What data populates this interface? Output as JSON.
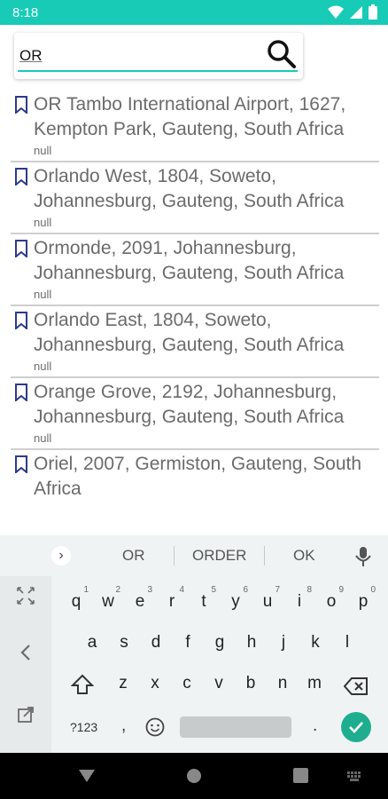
{
  "status_bar": {
    "time": "8:18",
    "icons": [
      "wifi-icon",
      "signal-icon",
      "battery-icon"
    ],
    "color": "#17cbb6"
  },
  "search": {
    "value": "OR",
    "icon": "search-icon",
    "accent": "#17cbb6"
  },
  "results": [
    {
      "title": "OR Tambo International  Airport, 1627, Kempton Park, Gauteng, South Africa",
      "subtitle": "null"
    },
    {
      "title": "Orlando West, 1804, Soweto, Johannesburg, Gauteng, South Africa",
      "subtitle": "null"
    },
    {
      "title": "Ormonde, 2091, Johannesburg, Johannesburg, Gauteng, South Africa",
      "subtitle": "null"
    },
    {
      "title": "Orlando East, 1804, Soweto, Johannesburg, Gauteng, South Africa",
      "subtitle": "null"
    },
    {
      "title": "Orange Grove, 2192, Johannesburg, Johannesburg, Gauteng, South Africa",
      "subtitle": "null"
    },
    {
      "title": "Oriel, 2007, Germiston, Gauteng, South Africa",
      "subtitle": ""
    }
  ],
  "keyboard": {
    "suggestions": [
      "OR",
      "ORDER",
      "OK"
    ],
    "row1": [
      "q",
      "w",
      "e",
      "r",
      "t",
      "y",
      "u",
      "i",
      "o",
      "p"
    ],
    "row1_hints": [
      "1",
      "2",
      "3",
      "4",
      "5",
      "6",
      "7",
      "8",
      "9",
      "0"
    ],
    "row2": [
      "a",
      "s",
      "d",
      "f",
      "g",
      "h",
      "j",
      "k",
      "l"
    ],
    "row3": [
      "z",
      "x",
      "c",
      "v",
      "b",
      "n",
      "m"
    ],
    "symbols_label": "?123",
    "comma_label": ",",
    "period_label": ".",
    "enter_color": "#1eae8f"
  }
}
